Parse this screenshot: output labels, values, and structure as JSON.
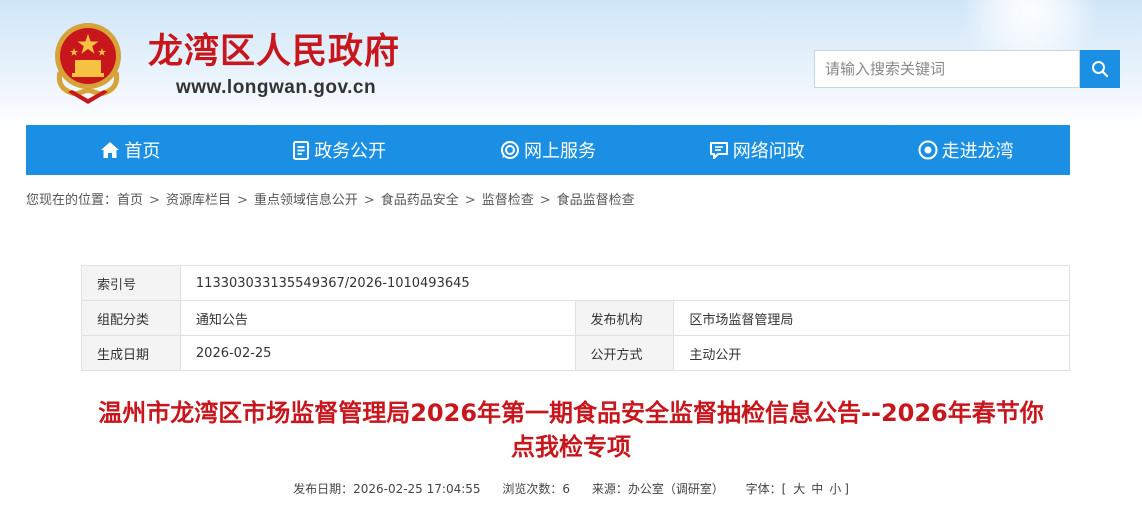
{
  "header": {
    "site_title": "龙湾区人民政府",
    "site_url": "www.longwan.gov.cn",
    "emblem_icon": "national-emblem-icon"
  },
  "search": {
    "placeholder": "请输入搜索关键词",
    "button_icon": "search-icon"
  },
  "colors": {
    "brand_blue": "#1a8fe3",
    "title_red": "#c8161d"
  },
  "nav": {
    "items": [
      {
        "label": "首页",
        "icon": "home-icon"
      },
      {
        "label": "政务公开",
        "icon": "document-icon"
      },
      {
        "label": "网上服务",
        "icon": "service-icon"
      },
      {
        "label": "网络问政",
        "icon": "chat-icon"
      },
      {
        "label": "走进龙湾",
        "icon": "eye-icon"
      }
    ]
  },
  "breadcrumb": {
    "prefix": "您现在的位置：",
    "items": [
      "首页",
      "资源库栏目",
      "重点领域信息公开",
      "食品药品安全",
      "监督检查",
      "食品监督检查"
    ],
    "separator": ">"
  },
  "info_table": {
    "index_label": "索引号",
    "index_value": "113303033135549367/2026-1010493645",
    "category_label": "组配分类",
    "category_value": "通知公告",
    "publisher_label": "发布机构",
    "publisher_value": "区市场监督管理局",
    "date_label": "生成日期",
    "date_value": "2026-02-25",
    "disclosure_label": "公开方式",
    "disclosure_value": "主动公开"
  },
  "article": {
    "title_line1": "温州市龙湾区市场监督管理局2026年第一期食品安全监督抽检信息公告--2026年春节你",
    "title_line2": "点我检专项",
    "publish_date": "发布日期：2026-02-25 17:04:55",
    "views": "浏览次数：6",
    "source": "来源：办公室（调研室）",
    "font_label": "字体：[",
    "font_large": "大",
    "font_medium": "中",
    "font_small": "小",
    "font_close": "]"
  }
}
